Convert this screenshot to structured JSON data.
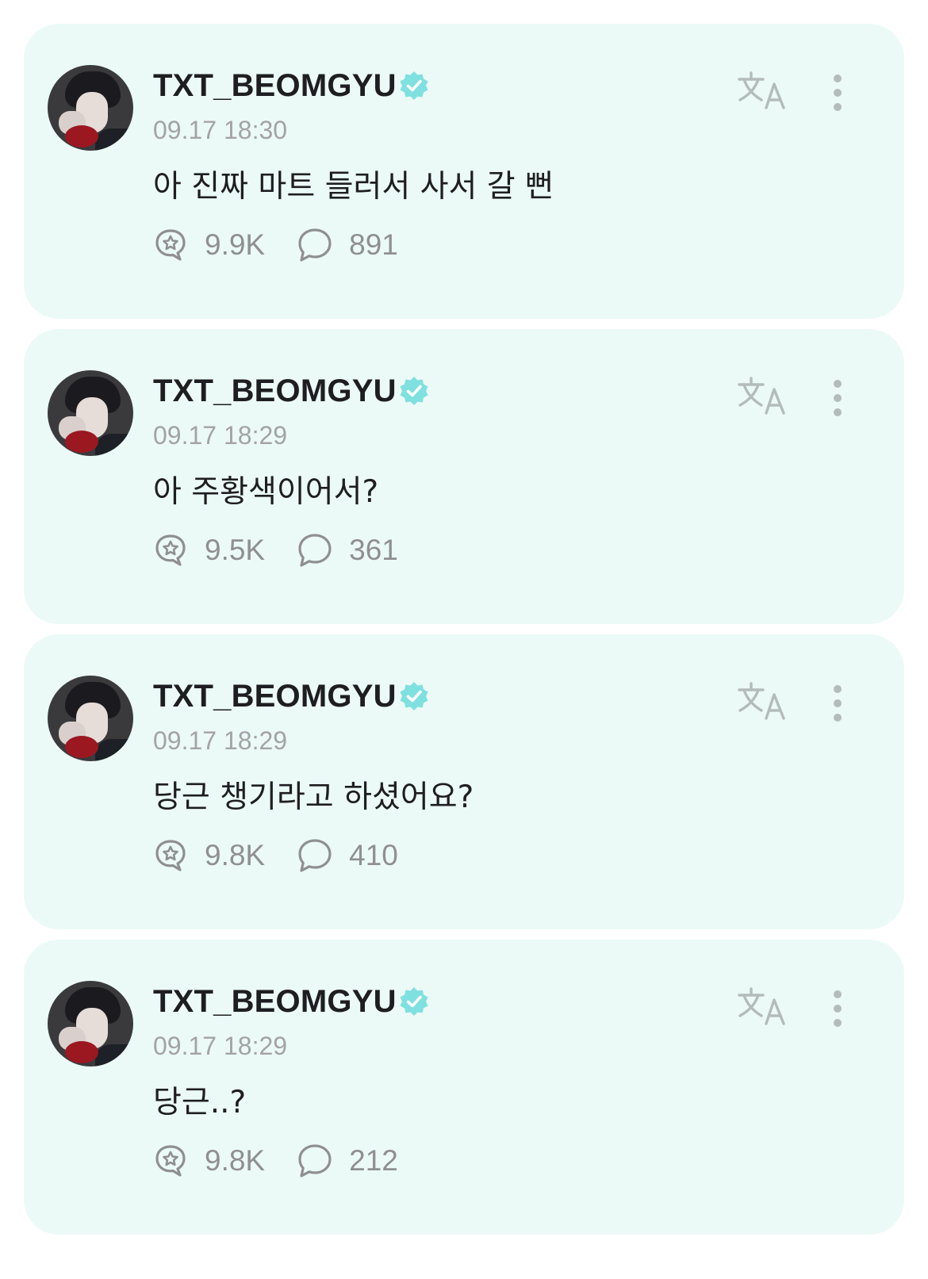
{
  "posts": [
    {
      "author": "TXT_BEOMGYU",
      "time": "09.17 18:30",
      "text": "아 진짜 마트 들러서 사서 갈 뻔",
      "likes": "9.9K",
      "comments": "891"
    },
    {
      "author": "TXT_BEOMGYU",
      "time": "09.17 18:29",
      "text": "아 주황색이어서?",
      "likes": "9.5K",
      "comments": "361"
    },
    {
      "author": "TXT_BEOMGYU",
      "time": "09.17 18:29",
      "text": "당근 챙기라고 하셨어요?",
      "likes": "9.8K",
      "comments": "410"
    },
    {
      "author": "TXT_BEOMGYU",
      "time": "09.17 18:29",
      "text": "당근..?",
      "likes": "9.8K",
      "comments": "212"
    }
  ],
  "icons": {
    "verified": "verified-badge-icon",
    "translate": "translate-icon",
    "more": "more-vertical-icon",
    "like": "like-bubble-icon",
    "comment": "comment-icon"
  },
  "colors": {
    "card_background": "#ebfaf6",
    "verified_badge": "#7fe0e0",
    "text_primary": "#1e1e22",
    "text_secondary": "#a3a3a6",
    "icon_gray": "#8f8f93"
  }
}
